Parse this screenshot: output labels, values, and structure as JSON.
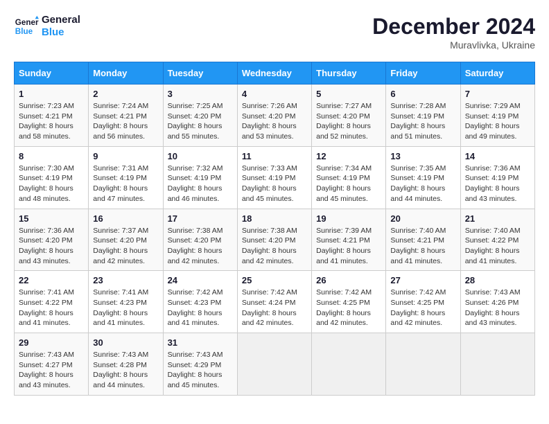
{
  "header": {
    "logo_line1": "General",
    "logo_line2": "Blue",
    "month_title": "December 2024",
    "location": "Muravlivka, Ukraine"
  },
  "weekdays": [
    "Sunday",
    "Monday",
    "Tuesday",
    "Wednesday",
    "Thursday",
    "Friday",
    "Saturday"
  ],
  "weeks": [
    [
      {
        "day": "1",
        "sunrise": "7:23 AM",
        "sunset": "4:21 PM",
        "daylight": "8 hours and 58 minutes."
      },
      {
        "day": "2",
        "sunrise": "7:24 AM",
        "sunset": "4:21 PM",
        "daylight": "8 hours and 56 minutes."
      },
      {
        "day": "3",
        "sunrise": "7:25 AM",
        "sunset": "4:20 PM",
        "daylight": "8 hours and 55 minutes."
      },
      {
        "day": "4",
        "sunrise": "7:26 AM",
        "sunset": "4:20 PM",
        "daylight": "8 hours and 53 minutes."
      },
      {
        "day": "5",
        "sunrise": "7:27 AM",
        "sunset": "4:20 PM",
        "daylight": "8 hours and 52 minutes."
      },
      {
        "day": "6",
        "sunrise": "7:28 AM",
        "sunset": "4:19 PM",
        "daylight": "8 hours and 51 minutes."
      },
      {
        "day": "7",
        "sunrise": "7:29 AM",
        "sunset": "4:19 PM",
        "daylight": "8 hours and 49 minutes."
      }
    ],
    [
      {
        "day": "8",
        "sunrise": "7:30 AM",
        "sunset": "4:19 PM",
        "daylight": "8 hours and 48 minutes."
      },
      {
        "day": "9",
        "sunrise": "7:31 AM",
        "sunset": "4:19 PM",
        "daylight": "8 hours and 47 minutes."
      },
      {
        "day": "10",
        "sunrise": "7:32 AM",
        "sunset": "4:19 PM",
        "daylight": "8 hours and 46 minutes."
      },
      {
        "day": "11",
        "sunrise": "7:33 AM",
        "sunset": "4:19 PM",
        "daylight": "8 hours and 45 minutes."
      },
      {
        "day": "12",
        "sunrise": "7:34 AM",
        "sunset": "4:19 PM",
        "daylight": "8 hours and 45 minutes."
      },
      {
        "day": "13",
        "sunrise": "7:35 AM",
        "sunset": "4:19 PM",
        "daylight": "8 hours and 44 minutes."
      },
      {
        "day": "14",
        "sunrise": "7:36 AM",
        "sunset": "4:19 PM",
        "daylight": "8 hours and 43 minutes."
      }
    ],
    [
      {
        "day": "15",
        "sunrise": "7:36 AM",
        "sunset": "4:20 PM",
        "daylight": "8 hours and 43 minutes."
      },
      {
        "day": "16",
        "sunrise": "7:37 AM",
        "sunset": "4:20 PM",
        "daylight": "8 hours and 42 minutes."
      },
      {
        "day": "17",
        "sunrise": "7:38 AM",
        "sunset": "4:20 PM",
        "daylight": "8 hours and 42 minutes."
      },
      {
        "day": "18",
        "sunrise": "7:38 AM",
        "sunset": "4:20 PM",
        "daylight": "8 hours and 42 minutes."
      },
      {
        "day": "19",
        "sunrise": "7:39 AM",
        "sunset": "4:21 PM",
        "daylight": "8 hours and 41 minutes."
      },
      {
        "day": "20",
        "sunrise": "7:40 AM",
        "sunset": "4:21 PM",
        "daylight": "8 hours and 41 minutes."
      },
      {
        "day": "21",
        "sunrise": "7:40 AM",
        "sunset": "4:22 PM",
        "daylight": "8 hours and 41 minutes."
      }
    ],
    [
      {
        "day": "22",
        "sunrise": "7:41 AM",
        "sunset": "4:22 PM",
        "daylight": "8 hours and 41 minutes."
      },
      {
        "day": "23",
        "sunrise": "7:41 AM",
        "sunset": "4:23 PM",
        "daylight": "8 hours and 41 minutes."
      },
      {
        "day": "24",
        "sunrise": "7:42 AM",
        "sunset": "4:23 PM",
        "daylight": "8 hours and 41 minutes."
      },
      {
        "day": "25",
        "sunrise": "7:42 AM",
        "sunset": "4:24 PM",
        "daylight": "8 hours and 42 minutes."
      },
      {
        "day": "26",
        "sunrise": "7:42 AM",
        "sunset": "4:25 PM",
        "daylight": "8 hours and 42 minutes."
      },
      {
        "day": "27",
        "sunrise": "7:42 AM",
        "sunset": "4:25 PM",
        "daylight": "8 hours and 42 minutes."
      },
      {
        "day": "28",
        "sunrise": "7:43 AM",
        "sunset": "4:26 PM",
        "daylight": "8 hours and 43 minutes."
      }
    ],
    [
      {
        "day": "29",
        "sunrise": "7:43 AM",
        "sunset": "4:27 PM",
        "daylight": "8 hours and 43 minutes."
      },
      {
        "day": "30",
        "sunrise": "7:43 AM",
        "sunset": "4:28 PM",
        "daylight": "8 hours and 44 minutes."
      },
      {
        "day": "31",
        "sunrise": "7:43 AM",
        "sunset": "4:29 PM",
        "daylight": "8 hours and 45 minutes."
      },
      null,
      null,
      null,
      null
    ]
  ]
}
